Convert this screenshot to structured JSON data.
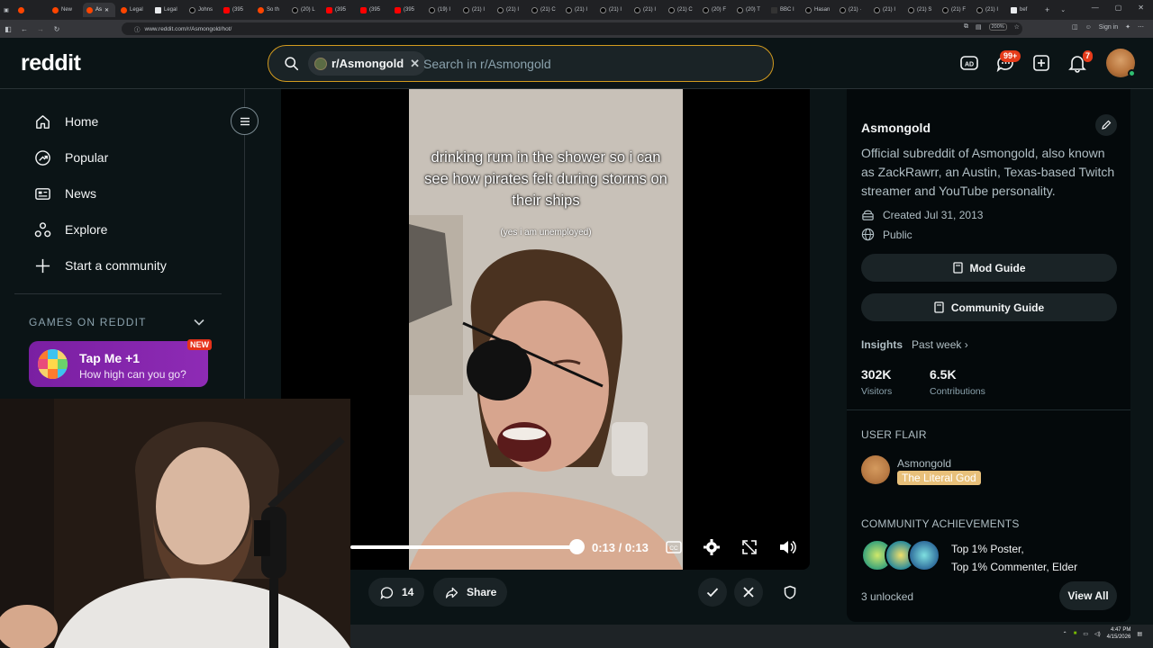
{
  "browser": {
    "tabs": [
      {
        "label": "",
        "icon": "reddit-icon"
      },
      {
        "label": "New",
        "icon": "reddit-icon"
      },
      {
        "label": "As",
        "icon": "reddit-icon",
        "active": true
      },
      {
        "label": "Legal",
        "icon": "reddit-icon"
      },
      {
        "label": "Legal",
        "icon": "page-icon"
      },
      {
        "label": "Johns",
        "icon": "x-icon"
      },
      {
        "label": "(395",
        "icon": "youtube-icon"
      },
      {
        "label": "So th",
        "icon": "reddit-icon"
      },
      {
        "label": "(20) L",
        "icon": "x-icon"
      },
      {
        "label": "(395",
        "icon": "youtube-icon"
      },
      {
        "label": "(395",
        "icon": "youtube-icon"
      },
      {
        "label": "(395",
        "icon": "youtube-icon"
      },
      {
        "label": "(19) I",
        "icon": "x-icon"
      },
      {
        "label": "(21) I",
        "icon": "x-icon"
      },
      {
        "label": "(21) I",
        "icon": "x-icon"
      },
      {
        "label": "(21) C",
        "icon": "x-icon"
      },
      {
        "label": "(21) I",
        "icon": "x-icon"
      },
      {
        "label": "(21) I",
        "icon": "x-icon"
      },
      {
        "label": "(21) I",
        "icon": "x-icon"
      },
      {
        "label": "(21) C",
        "icon": "x-icon"
      },
      {
        "label": "(20) F",
        "icon": "x-icon"
      },
      {
        "label": "(20) T",
        "icon": "x-icon"
      },
      {
        "label": "BBC I",
        "icon": "bbc-icon"
      },
      {
        "label": "Hasan",
        "icon": "x-icon"
      },
      {
        "label": "(21) ·",
        "icon": "x-icon"
      },
      {
        "label": "(21) I",
        "icon": "x-icon"
      },
      {
        "label": "(21) S",
        "icon": "x-icon"
      },
      {
        "label": "(21) F",
        "icon": "x-icon"
      },
      {
        "label": "(21) I",
        "icon": "x-icon"
      },
      {
        "label": "bef",
        "icon": "page-icon"
      }
    ],
    "url": "www.reddit.com/r/Asmongold/hot/",
    "zoom": "200%",
    "signin": "Sign in"
  },
  "header": {
    "logo": "reddit",
    "search_chip": "r/Asmongold",
    "search_placeholder": "Search in r/Asmongold",
    "chat_badge": "99+",
    "notif_badge": "7"
  },
  "sidebar": {
    "items": [
      {
        "label": "Home",
        "icon": "home-icon"
      },
      {
        "label": "Popular",
        "icon": "popular-icon"
      },
      {
        "label": "News",
        "icon": "news-icon"
      },
      {
        "label": "Explore",
        "icon": "explore-icon"
      },
      {
        "label": "Start a community",
        "icon": "plus-icon"
      }
    ],
    "games_header": "GAMES ON REDDIT",
    "game": {
      "title": "Tap Me +1",
      "subtitle": "How high can you go?",
      "badge": "NEW"
    }
  },
  "video": {
    "caption": "drinking rum in the shower so i can see how pirates felt during storms on their ships",
    "subcaption": "(yes i am unemployed)",
    "time": "0:13 / 0:13",
    "progress": 1.0
  },
  "actions": {
    "comments": "14",
    "share": "Share"
  },
  "community": {
    "name": "Asmongold",
    "description": "Official subreddit of Asmongold, also known as ZackRawrr, an Austin, Texas-based Twitch streamer and YouTube personality.",
    "created": "Created Jul 31, 2013",
    "visibility": "Public",
    "mod_guide": "Mod Guide",
    "community_guide": "Community Guide",
    "insights_label": "Insights",
    "insights_period": "Past week",
    "visitors_value": "302K",
    "visitors_label": "Visitors",
    "contributions_value": "6.5K",
    "contributions_label": "Contributions",
    "user_flair_header": "USER FLAIR",
    "flair_user": "Asmongold",
    "flair_tag": "The Literal God",
    "achievements_header": "COMMUNITY ACHIEVEMENTS",
    "achievement_1": "Top 1% Poster,",
    "achievement_2": "Top 1% Commenter, Elder",
    "unlocked": "3 unlocked",
    "view_all": "View All"
  },
  "taskbar": {
    "time": "4:47 PM",
    "date": "4/15/2026"
  },
  "colors": {
    "accent": "#d39b1f",
    "background": "#0b1416",
    "game_card": "#8e2bb5",
    "flair": "#e8c07a"
  }
}
